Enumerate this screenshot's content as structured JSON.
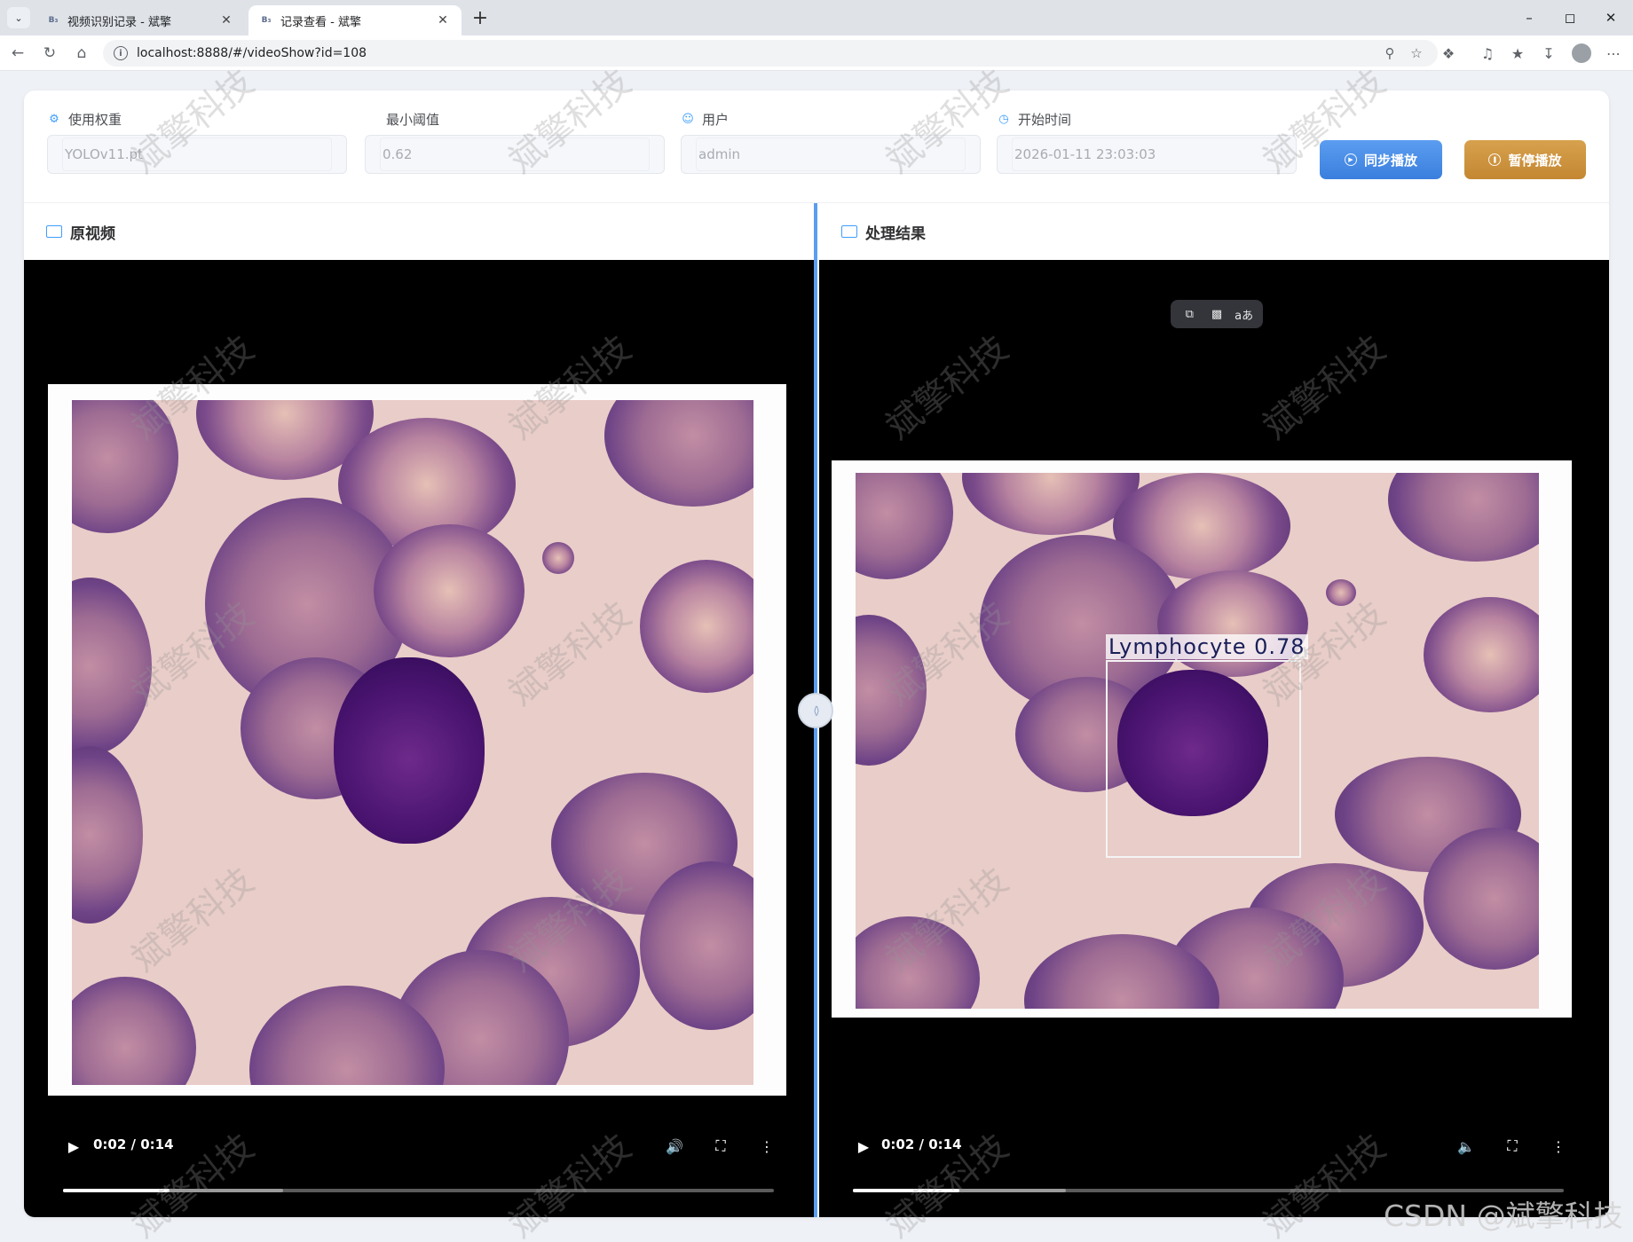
{
  "browser": {
    "tabs": [
      {
        "favicon": "B₃",
        "title": "视频识别记录 - 斌擎",
        "active": false
      },
      {
        "favicon": "B₃",
        "title": "记录查看 - 斌擎",
        "active": true
      }
    ],
    "url": "localhost:8888/#/videoShow?id=108"
  },
  "form": {
    "weight": {
      "label": "使用权重",
      "value": "YOLOv11.pt",
      "icon": "cpu-icon"
    },
    "threshold": {
      "label": "最小阈值",
      "value": "0.62"
    },
    "user": {
      "label": "用户",
      "value": "admin",
      "icon": "user-icon"
    },
    "start_time": {
      "label": "开始时间",
      "value": "2026-01-11 23:03:03",
      "icon": "clock-icon"
    }
  },
  "actions": {
    "sync_play": "同步播放",
    "pause_play": "暂停播放"
  },
  "panels": {
    "original": {
      "title": "原视频",
      "time": "0:02 / 0:14",
      "progress_played": 0.15,
      "progress_buffered": 0.31
    },
    "result": {
      "title": "处理结果",
      "time": "0:02 / 0:14",
      "progress_played": 0.15,
      "progress_buffered": 0.3,
      "detection": {
        "label": "Lymphocyte  0.78",
        "class": "Lymphocyte",
        "confidence": 0.78
      }
    }
  },
  "watermark_text": "斌擎科技",
  "footer_credit": "CSDN @斌擎科技",
  "colors": {
    "primary": "#409eff",
    "sync_button": "#4a8ee8",
    "pause_button": "#cf9540",
    "splitter": "#5b9df0"
  }
}
